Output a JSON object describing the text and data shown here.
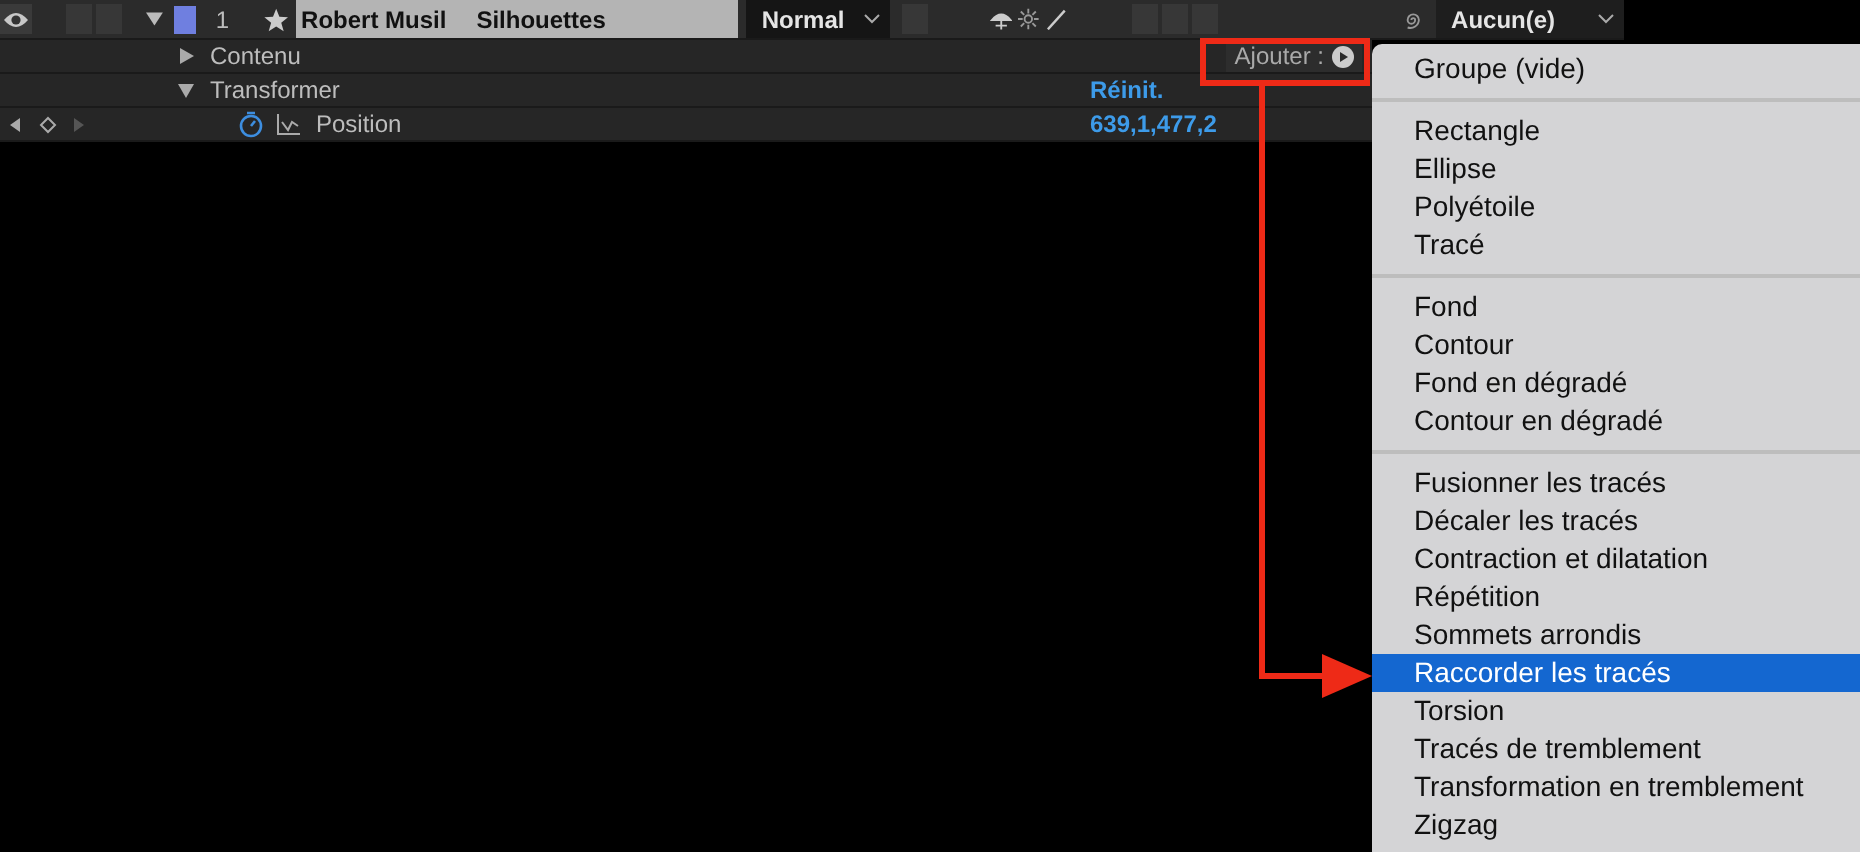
{
  "layer": {
    "visible": true,
    "expanded": true,
    "solo": false,
    "locked": false,
    "effects": false,
    "motion_blur": false,
    "adjustment": false,
    "number": "1",
    "name": "Robert Musil",
    "source": "Silhouettes",
    "mode": "Normal",
    "parent": "Aucun(e)"
  },
  "properties": [
    {
      "kind": "group",
      "label": "Contenu",
      "expanded": false,
      "action": "Ajouter :"
    },
    {
      "kind": "group",
      "label": "Transformer",
      "expanded": true,
      "action": "Réinit."
    },
    {
      "kind": "value",
      "label": "Position",
      "value": "639,1,477,2"
    }
  ],
  "menu": {
    "sections": [
      [
        {
          "label": "Groupe (vide)",
          "selected": false
        }
      ],
      [
        {
          "label": "Rectangle",
          "selected": false
        },
        {
          "label": "Ellipse",
          "selected": false
        },
        {
          "label": "Polyétoile",
          "selected": false
        },
        {
          "label": "Tracé",
          "selected": false
        }
      ],
      [
        {
          "label": "Fond",
          "selected": false
        },
        {
          "label": "Contour",
          "selected": false
        },
        {
          "label": "Fond en dégradé",
          "selected": false
        },
        {
          "label": "Contour en dégradé",
          "selected": false
        }
      ],
      [
        {
          "label": "Fusionner les tracés",
          "selected": false
        },
        {
          "label": "Décaler les tracés",
          "selected": false
        },
        {
          "label": "Contraction et dilatation",
          "selected": false
        },
        {
          "label": "Répétition",
          "selected": false
        },
        {
          "label": "Sommets arrondis",
          "selected": false
        },
        {
          "label": "Raccorder les tracés",
          "selected": true
        },
        {
          "label": "Torsion",
          "selected": false
        },
        {
          "label": "Tracés de tremblement",
          "selected": false
        },
        {
          "label": "Transformation en tremblement",
          "selected": false
        },
        {
          "label": "Zigzag",
          "selected": false
        }
      ]
    ]
  }
}
